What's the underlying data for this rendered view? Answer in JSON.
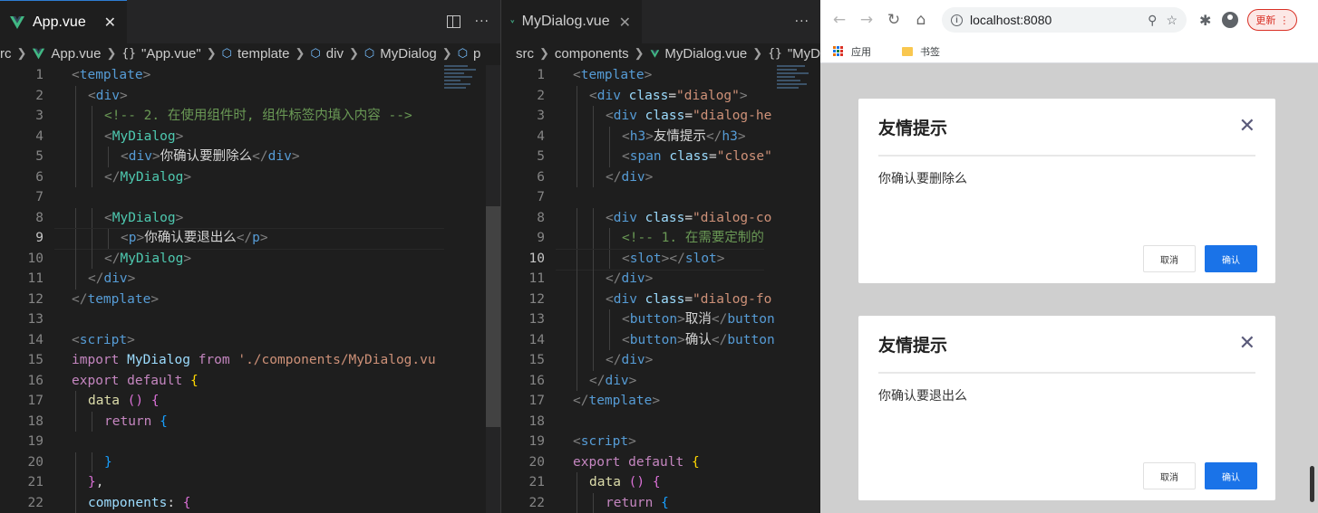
{
  "left_editor": {
    "tab_label": "App.vue",
    "breadcrumb": [
      "rc",
      "App.vue",
      "\"App.vue\"",
      "template",
      "div",
      "MyDialog",
      "p"
    ],
    "lines": [
      {
        "n": "1",
        "indent": 0,
        "parts": [
          [
            "t-punc",
            "<"
          ],
          [
            "t-tag",
            "template"
          ],
          [
            "t-punc",
            ">"
          ]
        ]
      },
      {
        "n": "2",
        "indent": 1,
        "parts": [
          [
            "t-punc",
            "<"
          ],
          [
            "t-tag",
            "div"
          ],
          [
            "t-punc",
            ">"
          ]
        ]
      },
      {
        "n": "3",
        "indent": 2,
        "parts": [
          [
            "t-comment",
            "<!-- 2. 在使用组件时, 组件标签内填入内容 -->"
          ]
        ]
      },
      {
        "n": "4",
        "indent": 2,
        "parts": [
          [
            "t-punc",
            "<"
          ],
          [
            "t-comp",
            "MyDialog"
          ],
          [
            "t-punc",
            ">"
          ]
        ]
      },
      {
        "n": "5",
        "indent": 3,
        "parts": [
          [
            "t-punc",
            "<"
          ],
          [
            "t-tag",
            "div"
          ],
          [
            "t-punc",
            ">"
          ],
          [
            "t-text",
            "你确认要删除么"
          ],
          [
            "t-punc",
            "</"
          ],
          [
            "t-tag",
            "div"
          ],
          [
            "t-punc",
            ">"
          ]
        ]
      },
      {
        "n": "6",
        "indent": 2,
        "parts": [
          [
            "t-punc",
            "</"
          ],
          [
            "t-comp",
            "MyDialog"
          ],
          [
            "t-punc",
            ">"
          ]
        ]
      },
      {
        "n": "7",
        "indent": 0,
        "parts": []
      },
      {
        "n": "8",
        "indent": 2,
        "parts": [
          [
            "t-punc",
            "<"
          ],
          [
            "t-comp",
            "MyDialog"
          ],
          [
            "t-punc",
            ">"
          ]
        ]
      },
      {
        "n": "9",
        "indent": 3,
        "parts": [
          [
            "t-punc",
            "<"
          ],
          [
            "t-tag",
            "p"
          ],
          [
            "t-punc",
            ">"
          ],
          [
            "t-text",
            "你确认要退出么"
          ],
          [
            "t-punc",
            "</"
          ],
          [
            "t-tag",
            "p"
          ],
          [
            "t-punc",
            ">"
          ]
        ],
        "active": true
      },
      {
        "n": "10",
        "indent": 2,
        "parts": [
          [
            "t-punc",
            "</"
          ],
          [
            "t-comp",
            "MyDialog"
          ],
          [
            "t-punc",
            ">"
          ]
        ]
      },
      {
        "n": "11",
        "indent": 1,
        "parts": [
          [
            "t-punc",
            "</"
          ],
          [
            "t-tag",
            "div"
          ],
          [
            "t-punc",
            ">"
          ]
        ]
      },
      {
        "n": "12",
        "indent": 0,
        "parts": [
          [
            "t-punc",
            "</"
          ],
          [
            "t-tag",
            "template"
          ],
          [
            "t-punc",
            ">"
          ]
        ]
      },
      {
        "n": "13",
        "indent": 0,
        "parts": []
      },
      {
        "n": "14",
        "indent": 0,
        "parts": [
          [
            "t-punc",
            "<"
          ],
          [
            "t-tag",
            "script"
          ],
          [
            "t-punc",
            ">"
          ]
        ]
      },
      {
        "n": "15",
        "indent": 0,
        "parts": [
          [
            "t-kw",
            "import "
          ],
          [
            "t-var",
            "MyDialog "
          ],
          [
            "t-kw",
            "from "
          ],
          [
            "t-str",
            "'./components/MyDialog.vu"
          ]
        ]
      },
      {
        "n": "16",
        "indent": 0,
        "parts": [
          [
            "t-kw",
            "export default "
          ],
          [
            "t-brace",
            "{"
          ]
        ]
      },
      {
        "n": "17",
        "indent": 1,
        "parts": [
          [
            "t-fn",
            "data "
          ],
          [
            "t-brace2",
            "()"
          ],
          [
            "t-text",
            " "
          ],
          [
            "t-brace2",
            "{"
          ]
        ]
      },
      {
        "n": "18",
        "indent": 2,
        "parts": [
          [
            "t-kw",
            "return "
          ],
          [
            "t-brace3",
            "{"
          ]
        ]
      },
      {
        "n": "19",
        "indent": 0,
        "parts": []
      },
      {
        "n": "20",
        "indent": 2,
        "parts": [
          [
            "t-brace3",
            "}"
          ]
        ]
      },
      {
        "n": "21",
        "indent": 1,
        "parts": [
          [
            "t-brace2",
            "}"
          ],
          [
            "t-text",
            ","
          ]
        ]
      },
      {
        "n": "22",
        "indent": 1,
        "parts": [
          [
            "t-prop",
            "components"
          ],
          [
            "t-text",
            ": "
          ],
          [
            "t-brace2",
            "{"
          ]
        ]
      }
    ]
  },
  "mid_editor": {
    "tab_label": "MyDialog.vue",
    "breadcrumb": [
      "src",
      "components",
      "MyDialog.vue",
      "\"MyD"
    ],
    "lines": [
      {
        "n": "1",
        "indent": 0,
        "parts": [
          [
            "t-punc",
            "<"
          ],
          [
            "t-tag",
            "template"
          ],
          [
            "t-punc",
            ">"
          ]
        ]
      },
      {
        "n": "2",
        "indent": 1,
        "parts": [
          [
            "t-punc",
            "<"
          ],
          [
            "t-tag",
            "div "
          ],
          [
            "t-attr",
            "class"
          ],
          [
            "t-text",
            "="
          ],
          [
            "t-str",
            "\"dialog\""
          ],
          [
            "t-punc",
            ">"
          ]
        ]
      },
      {
        "n": "3",
        "indent": 2,
        "parts": [
          [
            "t-punc",
            "<"
          ],
          [
            "t-tag",
            "div "
          ],
          [
            "t-attr",
            "class"
          ],
          [
            "t-text",
            "="
          ],
          [
            "t-str",
            "\"dialog-he"
          ]
        ]
      },
      {
        "n": "4",
        "indent": 3,
        "parts": [
          [
            "t-punc",
            "<"
          ],
          [
            "t-tag",
            "h3"
          ],
          [
            "t-punc",
            ">"
          ],
          [
            "t-text",
            "友情提示"
          ],
          [
            "t-punc",
            "</"
          ],
          [
            "t-tag",
            "h3"
          ],
          [
            "t-punc",
            ">"
          ]
        ]
      },
      {
        "n": "5",
        "indent": 3,
        "parts": [
          [
            "t-punc",
            "<"
          ],
          [
            "t-tag",
            "span "
          ],
          [
            "t-attr",
            "class"
          ],
          [
            "t-text",
            "="
          ],
          [
            "t-str",
            "\"close\""
          ]
        ]
      },
      {
        "n": "6",
        "indent": 2,
        "parts": [
          [
            "t-punc",
            "</"
          ],
          [
            "t-tag",
            "div"
          ],
          [
            "t-punc",
            ">"
          ]
        ]
      },
      {
        "n": "7",
        "indent": 0,
        "parts": []
      },
      {
        "n": "8",
        "indent": 2,
        "parts": [
          [
            "t-punc",
            "<"
          ],
          [
            "t-tag",
            "div "
          ],
          [
            "t-attr",
            "class"
          ],
          [
            "t-text",
            "="
          ],
          [
            "t-str",
            "\"dialog-co"
          ]
        ]
      },
      {
        "n": "9",
        "indent": 3,
        "parts": [
          [
            "t-comment",
            "<!-- 1. 在需要定制的"
          ]
        ]
      },
      {
        "n": "10",
        "indent": 3,
        "parts": [
          [
            "t-punc",
            "<"
          ],
          [
            "t-tag",
            "slot"
          ],
          [
            "t-punc",
            "></"
          ],
          [
            "t-tag",
            "slot"
          ],
          [
            "t-punc",
            ">"
          ]
        ],
        "active": true
      },
      {
        "n": "11",
        "indent": 2,
        "parts": [
          [
            "t-punc",
            "</"
          ],
          [
            "t-tag",
            "div"
          ],
          [
            "t-punc",
            ">"
          ]
        ]
      },
      {
        "n": "12",
        "indent": 2,
        "parts": [
          [
            "t-punc",
            "<"
          ],
          [
            "t-tag",
            "div "
          ],
          [
            "t-attr",
            "class"
          ],
          [
            "t-text",
            "="
          ],
          [
            "t-str",
            "\"dialog-fo"
          ]
        ]
      },
      {
        "n": "13",
        "indent": 3,
        "parts": [
          [
            "t-punc",
            "<"
          ],
          [
            "t-tag",
            "button"
          ],
          [
            "t-punc",
            ">"
          ],
          [
            "t-text",
            "取消"
          ],
          [
            "t-punc",
            "</"
          ],
          [
            "t-tag",
            "button"
          ]
        ]
      },
      {
        "n": "14",
        "indent": 3,
        "parts": [
          [
            "t-punc",
            "<"
          ],
          [
            "t-tag",
            "button"
          ],
          [
            "t-punc",
            ">"
          ],
          [
            "t-text",
            "确认"
          ],
          [
            "t-punc",
            "</"
          ],
          [
            "t-tag",
            "button"
          ]
        ]
      },
      {
        "n": "15",
        "indent": 2,
        "parts": [
          [
            "t-punc",
            "</"
          ],
          [
            "t-tag",
            "div"
          ],
          [
            "t-punc",
            ">"
          ]
        ]
      },
      {
        "n": "16",
        "indent": 1,
        "parts": [
          [
            "t-punc",
            "</"
          ],
          [
            "t-tag",
            "div"
          ],
          [
            "t-punc",
            ">"
          ]
        ]
      },
      {
        "n": "17",
        "indent": 0,
        "parts": [
          [
            "t-punc",
            "</"
          ],
          [
            "t-tag",
            "template"
          ],
          [
            "t-punc",
            ">"
          ]
        ]
      },
      {
        "n": "18",
        "indent": 0,
        "parts": []
      },
      {
        "n": "19",
        "indent": 0,
        "parts": [
          [
            "t-punc",
            "<"
          ],
          [
            "t-tag",
            "script"
          ],
          [
            "t-punc",
            ">"
          ]
        ]
      },
      {
        "n": "20",
        "indent": 0,
        "parts": [
          [
            "t-kw",
            "export default "
          ],
          [
            "t-brace",
            "{"
          ]
        ]
      },
      {
        "n": "21",
        "indent": 1,
        "parts": [
          [
            "t-fn",
            "data "
          ],
          [
            "t-brace2",
            "()"
          ],
          [
            "t-text",
            " "
          ],
          [
            "t-brace2",
            "{"
          ]
        ]
      },
      {
        "n": "22",
        "indent": 2,
        "parts": [
          [
            "t-kw",
            "return "
          ],
          [
            "t-brace3",
            "{"
          ]
        ]
      }
    ]
  },
  "browser": {
    "url": "localhost:8080",
    "update_label": "更新",
    "bookmarks": {
      "apps_label": "应用",
      "folder_label": "书签"
    },
    "dialogs": [
      {
        "title": "友情提示",
        "close": "✕",
        "body": "你确认要删除么",
        "cancel": "取消",
        "ok": "确认"
      },
      {
        "title": "友情提示",
        "close": "✕",
        "body": "你确认要退出么",
        "cancel": "取消",
        "ok": "确认"
      }
    ]
  },
  "colors": {
    "editor_bg": "#1e1e1e",
    "vue_green": "#41b883",
    "primary_button": "#1a73e8"
  }
}
